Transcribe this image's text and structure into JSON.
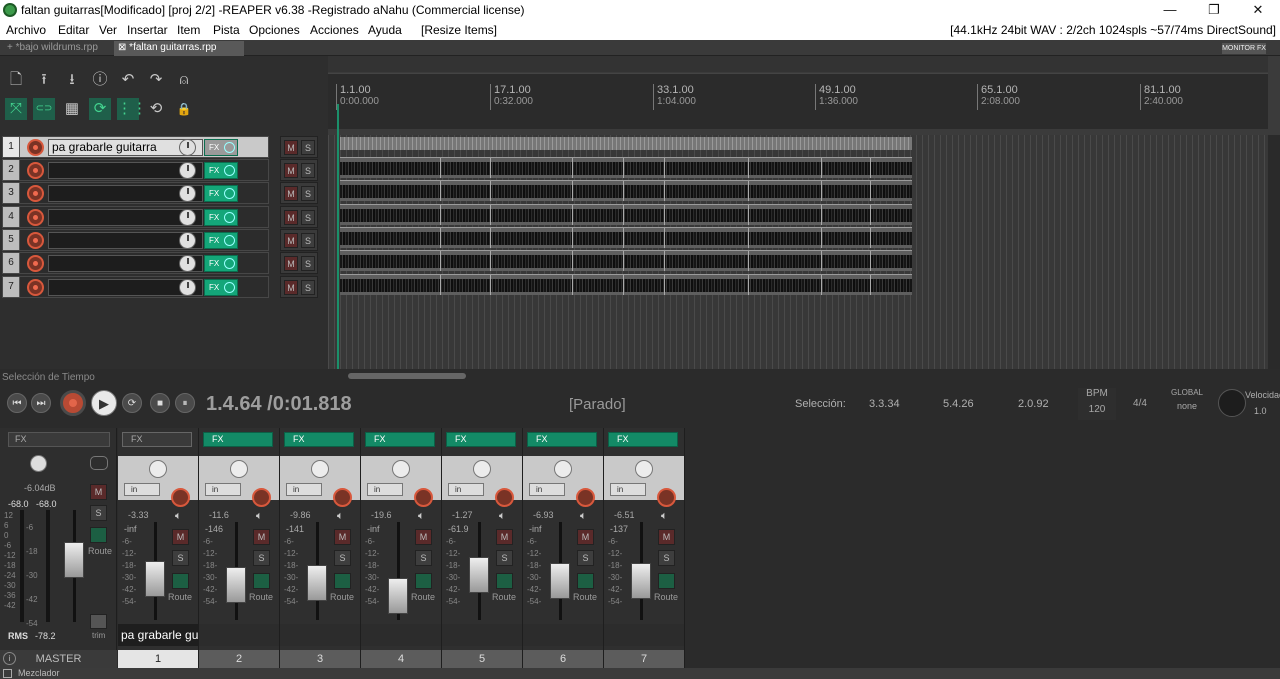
{
  "window": {
    "title": "faltan guitarras[Modificado] [proj 2/2] -REAPER v6.38 -Registrado aNahu (Commercial license)",
    "min_icon": "minimize-icon",
    "max_icon": "maximize-icon",
    "close_icon": "close-icon",
    "min": "—",
    "max": "❐",
    "close": "✕"
  },
  "menu": {
    "items": [
      "Archivo",
      "Editar",
      "Ver",
      "Insertar",
      "Item",
      "Pista",
      "Opciones",
      "Acciones",
      "Ayuda",
      "[Resize Items]"
    ],
    "status": "[44.1kHz 24bit WAV : 2/2ch 1024spls ~57/74ms DirectSound]"
  },
  "project_tabs": [
    {
      "label": "*bajo wildrums.rpp",
      "prefix": "+"
    },
    {
      "label": "*faltan guitarras.rpp",
      "prefix": "⊠"
    }
  ],
  "monitor_fx": "MONITOR FX",
  "toolbar": {
    "row1": [
      "new-file-icon",
      "save-icon",
      "download-icon",
      "info-icon",
      "undo-icon",
      "redo-icon",
      "metronome-icon"
    ],
    "row2": [
      "ripple-icon",
      "link-icon",
      "grid-icon",
      "snap-icon",
      "snap-lines-icon",
      "loop-icon",
      "lock-icon"
    ],
    "row1_glyphs": [
      "🗋",
      "⭱",
      "⭳",
      "ⓘ",
      "↶",
      "↷",
      "⍝"
    ],
    "row2_glyphs": [
      "⤧",
      "⊂⊃",
      "▦",
      "⟳",
      "⋮⋮",
      "⟲",
      "🔒"
    ]
  },
  "tracks": [
    {
      "num": "1",
      "name": "pa grabarle  guitarra",
      "m": "M",
      "s": "S",
      "fx": "FX"
    },
    {
      "num": "2",
      "name": "",
      "m": "M",
      "s": "S",
      "fx": "FX"
    },
    {
      "num": "3",
      "name": "",
      "m": "M",
      "s": "S",
      "fx": "FX"
    },
    {
      "num": "4",
      "name": "",
      "m": "M",
      "s": "S",
      "fx": "FX"
    },
    {
      "num": "5",
      "name": "",
      "m": "M",
      "s": "S",
      "fx": "FX"
    },
    {
      "num": "6",
      "name": "",
      "m": "M",
      "s": "S",
      "fx": "FX"
    },
    {
      "num": "7",
      "name": "",
      "m": "M",
      "s": "S",
      "fx": "FX"
    }
  ],
  "ruler": [
    {
      "bar": "1.1.00",
      "time": "0:00.000"
    },
    {
      "bar": "17.1.00",
      "time": "0:32.000"
    },
    {
      "bar": "33.1.00",
      "time": "1:04.000"
    },
    {
      "bar": "49.1.00",
      "time": "1:36.000"
    },
    {
      "bar": "65.1.00",
      "time": "2:08.000"
    },
    {
      "bar": "81.1.00",
      "time": "2:40.000"
    }
  ],
  "time_selection_label": "Selección de Tiempo",
  "transport": {
    "position": "1.4.64 /0:01.818",
    "status": "[Parado]",
    "selection_label": "Selección:",
    "sel_start": "3.3.34",
    "sel_end": "5.4.26",
    "sel_len": "2.0.92",
    "bpm_label": "BPM",
    "bpm": "120",
    "timesig": "4/4",
    "global_label": "GLOBAL",
    "global_value": "none",
    "rate_label": "Velocidad",
    "rate_value": "1.0",
    "buttons": {
      "skip_start": "⏮",
      "skip_end": "⏭",
      "play": "▶",
      "repeat": "⟳",
      "stop": "■",
      "pause": "⏸"
    }
  },
  "master": {
    "fx": "FX",
    "db": "-6.04dB",
    "peak_l": "-68.0",
    "peak_r": "-68.0",
    "m": "M",
    "s": "S",
    "route": "Route",
    "rms_label": "RMS",
    "rms": "-78.2",
    "trim": "trim",
    "label": "MASTER",
    "scale": [
      "12",
      "6",
      "0",
      "-6",
      "-12",
      "-18",
      "-24",
      "-30",
      "-36",
      "-42"
    ],
    "scale2": [
      "-6",
      "-18",
      "-30",
      "-42",
      "-54"
    ]
  },
  "mixer_strips": [
    {
      "num": "1",
      "name": "pa grabarle  guitarra",
      "vol": "-3.33",
      "meter_top": "-inf",
      "fx": "FX",
      "in": "in",
      "m": "M",
      "s": "S",
      "route": "Route",
      "fader_level": 0.42
    },
    {
      "num": "2",
      "name": "",
      "vol": "-11.6",
      "meter_top": "-146",
      "fx": "FX",
      "in": "in",
      "m": "M",
      "s": "S",
      "route": "Route",
      "fader_level": 0.36
    },
    {
      "num": "3",
      "name": "",
      "vol": "-9.86",
      "meter_top": "-141",
      "fx": "FX",
      "in": "in",
      "m": "M",
      "s": "S",
      "route": "Route",
      "fader_level": 0.38
    },
    {
      "num": "4",
      "name": "",
      "vol": "-19.6",
      "meter_top": "-inf",
      "fx": "FX",
      "in": "in",
      "m": "M",
      "s": "S",
      "route": "Route",
      "fader_level": 0.24
    },
    {
      "num": "5",
      "name": "",
      "vol": "-1.27",
      "meter_top": "-61.9",
      "fx": "FX",
      "in": "in",
      "m": "M",
      "s": "S",
      "route": "Route",
      "fader_level": 0.46
    },
    {
      "num": "6",
      "name": "",
      "vol": "-6.93",
      "meter_top": "-inf",
      "fx": "FX",
      "in": "in",
      "m": "M",
      "s": "S",
      "route": "Route",
      "fader_level": 0.4
    },
    {
      "num": "7",
      "name": "",
      "vol": "-6.51",
      "meter_top": "-137",
      "fx": "FX",
      "in": "in",
      "m": "M",
      "s": "S",
      "route": "Route",
      "fader_level": 0.4
    }
  ],
  "strip_scale": [
    "-6-",
    "-12-",
    "-18-",
    "-30-",
    "-42-",
    "-54-"
  ],
  "mixer_tab": "Mezclador"
}
